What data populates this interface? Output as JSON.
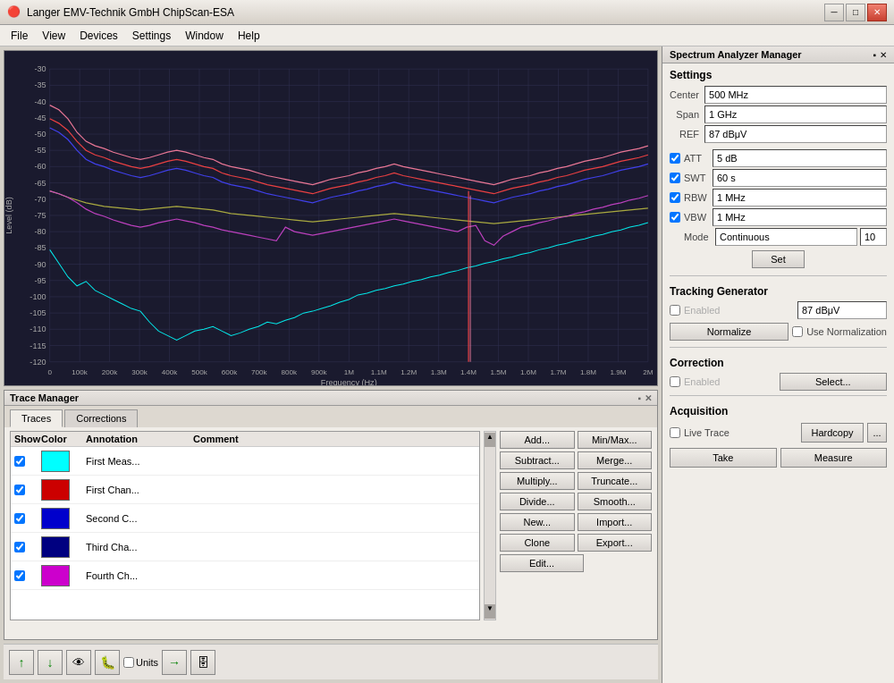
{
  "titleBar": {
    "icon": "🔴",
    "title": "Langer EMV-Technik GmbH ChipScan-ESA",
    "minBtn": "─",
    "maxBtn": "□",
    "closeBtn": "✕"
  },
  "menuBar": {
    "items": [
      "File",
      "View",
      "Devices",
      "Settings",
      "Window",
      "Help"
    ]
  },
  "chart": {
    "yAxisLabel": "Level (dB)",
    "xAxisLabel": "Frequency (Hz)",
    "yTicks": [
      "-30",
      "-35",
      "-40",
      "-45",
      "-50",
      "-55",
      "-60",
      "-65",
      "-70",
      "-75",
      "-80",
      "-85",
      "-90",
      "-95",
      "-100",
      "-105",
      "-110",
      "-115",
      "-120"
    ],
    "xTicks": [
      "0",
      "100k",
      "200k",
      "300k",
      "400k",
      "500k",
      "600k",
      "700k",
      "800k",
      "900k",
      "1M",
      "1.1M",
      "1.2M",
      "1.3M",
      "1.4M",
      "1.5M",
      "1.6M",
      "1.7M",
      "1.8M",
      "1.9M",
      "2M"
    ]
  },
  "traceManager": {
    "title": "Trace Manager",
    "tabs": [
      "Traces",
      "Corrections"
    ],
    "activeTab": "Traces",
    "tableHeaders": [
      "Show",
      "Color",
      "Annotation",
      "Comment"
    ],
    "rows": [
      {
        "show": true,
        "color": "#00ffff",
        "annotation": "First Meas...",
        "comment": ""
      },
      {
        "show": true,
        "color": "#cc0000",
        "annotation": "First Chan...",
        "comment": ""
      },
      {
        "show": true,
        "color": "#0000cc",
        "annotation": "Second C...",
        "comment": ""
      },
      {
        "show": true,
        "color": "#000080",
        "annotation": "Third Cha...",
        "comment": ""
      },
      {
        "show": true,
        "color": "#cc00cc",
        "annotation": "Fourth Ch...",
        "comment": ""
      }
    ],
    "buttons": {
      "row1": [
        "Add...",
        "Min/Max..."
      ],
      "row2": [
        "Subtract...",
        "Merge..."
      ],
      "row3": [
        "Multiply...",
        "Truncate..."
      ],
      "row4": [
        "Divide...",
        "Smooth..."
      ],
      "row5": [
        "New...",
        "Import..."
      ],
      "row6": [
        "Clone",
        "Export..."
      ],
      "row7": [
        "Edit..."
      ]
    }
  },
  "bottomToolbar": {
    "upBtn": "↑",
    "downBtn": "↓",
    "eyeBtn": "👁",
    "bugBtn": "🐛",
    "unitsLabel": "Units",
    "arrowBtn": "→",
    "dbBtn": "🗄"
  },
  "spectrumAnalyzer": {
    "title": "Spectrum  Analyzer Manager",
    "pinBtn": "▪ ✕",
    "sections": {
      "settings": {
        "title": "Settings",
        "fields": {
          "center": {
            "label": "Center",
            "value": "500 MHz"
          },
          "span": {
            "label": "Span",
            "value": "1 GHz"
          },
          "ref": {
            "label": "REF",
            "value": "87 dBμV"
          },
          "att": {
            "label": "ATT",
            "value": "5 dB",
            "checked": true
          },
          "swt": {
            "label": "SWT",
            "value": "60 s",
            "checked": true
          },
          "rbw": {
            "label": "RBW",
            "value": "1 MHz",
            "checked": true
          },
          "vbw": {
            "label": "VBW",
            "value": "1 MHz",
            "checked": true
          },
          "mode": {
            "label": "Mode",
            "value": "Continuous",
            "extra": "10"
          }
        },
        "setBtn": "Set"
      },
      "trackingGenerator": {
        "title": "Tracking Generator",
        "enabled": false,
        "enabledLabel": "Enabled",
        "value": "87 dBμV",
        "normalizeBtn": "Normalize",
        "useNormalization": false,
        "useNormalizationLabel": "Use Normalization"
      },
      "correction": {
        "title": "Correction",
        "enabled": false,
        "enabledLabel": "Enabled",
        "selectBtn": "Select..."
      },
      "acquisition": {
        "title": "Acquisition",
        "liveTrace": false,
        "liveTraceLabel": "Live Trace",
        "hardcopyBtn": "Hardcopy",
        "moreBtn": "...",
        "takeBtn": "Take",
        "measureBtn": "Measure"
      }
    }
  }
}
